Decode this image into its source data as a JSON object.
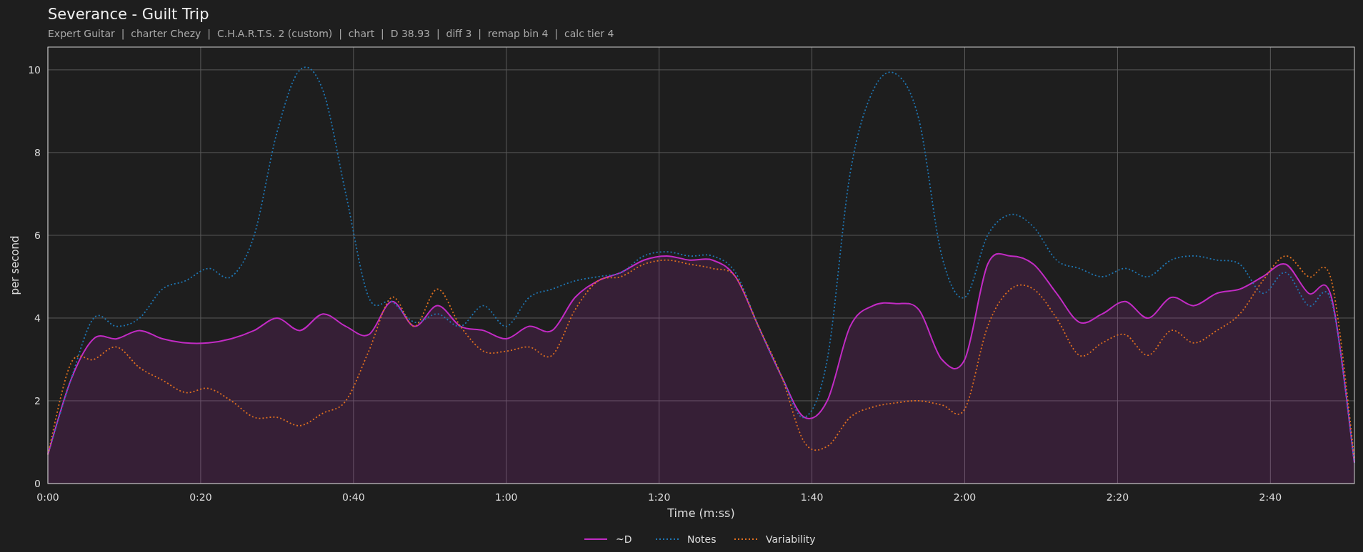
{
  "header": {
    "title": "Severance - Guilt Trip",
    "subtitle": "Expert Guitar  |  charter Chezy  |  C.H.A.R.T.S. 2 (custom)  |  chart  |  D 38.93  |  diff 3  |  remap bin 4  |  calc tier 4"
  },
  "chart": {
    "chart_data": {
      "type": "line",
      "xlabel": "Time (m:ss)",
      "ylabel": "per second",
      "x": [
        0,
        3,
        6,
        9,
        12,
        15,
        18,
        21,
        24,
        27,
        30,
        33,
        36,
        39,
        42,
        45,
        48,
        51,
        54,
        57,
        60,
        63,
        66,
        69,
        72,
        75,
        78,
        81,
        84,
        87,
        90,
        93,
        96,
        99,
        102,
        105,
        108,
        111,
        114,
        117,
        120,
        123,
        126,
        129,
        132,
        135,
        138,
        141,
        144,
        147,
        150,
        153,
        156,
        159,
        162,
        165,
        168,
        171
      ],
      "series": [
        {
          "name": "~D",
          "color": "#c22bc4",
          "line_style": "solid",
          "values": [
            0.7,
            2.5,
            3.5,
            3.5,
            3.7,
            3.5,
            3.4,
            3.4,
            3.5,
            3.7,
            4.0,
            3.7,
            4.1,
            3.8,
            3.6,
            4.4,
            3.8,
            4.3,
            3.8,
            3.7,
            3.5,
            3.8,
            3.7,
            4.5,
            4.9,
            5.1,
            5.4,
            5.5,
            5.4,
            5.4,
            5.0,
            3.8,
            2.6,
            1.6,
            2.0,
            3.8,
            4.3,
            4.35,
            4.2,
            3.0,
            3.0,
            5.3,
            5.5,
            5.3,
            4.6,
            3.9,
            4.1,
            4.4,
            4.0,
            4.5,
            4.3,
            4.6,
            4.7,
            5.0,
            5.3,
            4.6,
            4.5,
            0.5
          ]
        },
        {
          "name": "Notes",
          "color": "#1f77b4",
          "line_style": "dotted",
          "values": [
            0.7,
            2.5,
            4.0,
            3.8,
            4.0,
            4.7,
            4.9,
            5.2,
            5.0,
            6.0,
            8.5,
            10.0,
            9.5,
            7.0,
            4.5,
            4.4,
            3.9,
            4.1,
            3.8,
            4.3,
            3.8,
            4.5,
            4.7,
            4.9,
            5.0,
            5.1,
            5.5,
            5.6,
            5.5,
            5.5,
            5.1,
            3.8,
            2.6,
            1.6,
            3.0,
            7.5,
            9.5,
            9.9,
            8.8,
            5.5,
            4.5,
            6.0,
            6.5,
            6.2,
            5.4,
            5.2,
            5.0,
            5.2,
            5.0,
            5.4,
            5.5,
            5.4,
            5.3,
            4.6,
            5.1,
            4.3,
            4.4,
            0.5
          ]
        },
        {
          "name": "Variability",
          "color": "#e0701f",
          "line_style": "dotted",
          "values": [
            0.7,
            2.9,
            3.0,
            3.3,
            2.8,
            2.5,
            2.2,
            2.3,
            2.0,
            1.6,
            1.6,
            1.4,
            1.7,
            2.0,
            3.2,
            4.5,
            3.8,
            4.7,
            3.8,
            3.2,
            3.2,
            3.3,
            3.1,
            4.2,
            4.9,
            5.0,
            5.3,
            5.4,
            5.3,
            5.2,
            5.0,
            3.8,
            2.6,
            1.0,
            0.9,
            1.6,
            1.85,
            1.95,
            2.0,
            1.9,
            1.8,
            3.8,
            4.7,
            4.7,
            4.0,
            3.1,
            3.4,
            3.6,
            3.1,
            3.7,
            3.4,
            3.7,
            4.1,
            4.9,
            5.5,
            5.0,
            4.9,
            0.6
          ]
        }
      ],
      "grid": true,
      "legend": true,
      "xlim": [
        0,
        171
      ],
      "ylim": [
        0,
        10.55
      ],
      "xticks": [
        {
          "value": 0,
          "label": "0:00"
        },
        {
          "value": 20,
          "label": "0:20"
        },
        {
          "value": 40,
          "label": "0:40"
        },
        {
          "value": 60,
          "label": "1:00"
        },
        {
          "value": 80,
          "label": "1:20"
        },
        {
          "value": 100,
          "label": "1:40"
        },
        {
          "value": 120,
          "label": "2:00"
        },
        {
          "value": 140,
          "label": "2:20"
        },
        {
          "value": 160,
          "label": "2:40"
        }
      ],
      "yticks": [
        0,
        2,
        4,
        6,
        8,
        10
      ]
    }
  }
}
